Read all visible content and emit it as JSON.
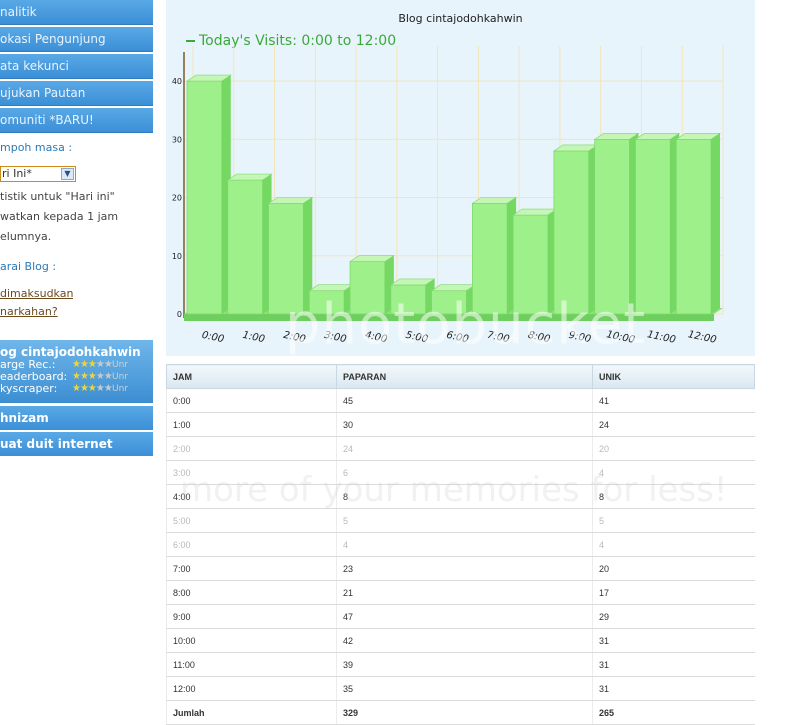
{
  "sidebar": {
    "menu": [
      "nalitik",
      "okasi Pengunjung",
      "ata kekunci",
      "ujukan Pautan",
      "omuniti *BARU!"
    ],
    "period_label": "mpoh masa :",
    "period_value": "ri Ini*",
    "note_lines": [
      "tistik untuk \"Hari ini\"",
      "watkan kepada 1 jam",
      "elumnya."
    ],
    "blog_list_label": "arai Blog :",
    "links": [
      "dimaksudkan",
      "narkahan?"
    ],
    "blog_box": {
      "title": "og cintajodohkahwin",
      "rows": [
        {
          "label": "arge Rec.:",
          "rank": "Unr"
        },
        {
          "label": "eaderboard:",
          "rank": "Unr"
        },
        {
          "label": "kyscraper:",
          "rank": "Unr"
        }
      ]
    },
    "buttons": [
      "hnizam",
      "uat duit internet"
    ]
  },
  "chart_data": {
    "type": "bar",
    "title": "Blog cintajodohkahwin",
    "series": [
      {
        "name": "Today's Visits: 0:00 to 12:00",
        "values": [
          40,
          23,
          19,
          4,
          9,
          5,
          4,
          19,
          17,
          28,
          30,
          30,
          30
        ]
      }
    ],
    "categories": [
      "0:00",
      "1:00",
      "2:00",
      "3:00",
      "4:00",
      "5:00",
      "6:00",
      "7:00",
      "8:00",
      "9:00",
      "10:00",
      "11:00",
      "12:00"
    ],
    "ylim": [
      0,
      45
    ],
    "yticks": [
      0,
      10,
      20,
      30,
      40
    ],
    "grid": true,
    "colors": {
      "bar": "#9ef08a",
      "bar_dark": "#6fd65e",
      "legend": "#3aa93a"
    }
  },
  "table": {
    "headers": [
      "JAM",
      "PAPARAN",
      "UNIK"
    ],
    "rows": [
      {
        "jam": "0:00",
        "paparan": "45",
        "unik": "41",
        "dim": false
      },
      {
        "jam": "1:00",
        "paparan": "30",
        "unik": "24",
        "dim": false
      },
      {
        "jam": "2:00",
        "paparan": "24",
        "unik": "20",
        "dim": true
      },
      {
        "jam": "3:00",
        "paparan": "6",
        "unik": "4",
        "dim": true
      },
      {
        "jam": "4:00",
        "paparan": "8",
        "unik": "8",
        "dim": false
      },
      {
        "jam": "5:00",
        "paparan": "5",
        "unik": "5",
        "dim": true
      },
      {
        "jam": "6:00",
        "paparan": "4",
        "unik": "4",
        "dim": true
      },
      {
        "jam": "7:00",
        "paparan": "23",
        "unik": "20",
        "dim": false
      },
      {
        "jam": "8:00",
        "paparan": "21",
        "unik": "17",
        "dim": false
      },
      {
        "jam": "9:00",
        "paparan": "47",
        "unik": "29",
        "dim": false
      },
      {
        "jam": "10:00",
        "paparan": "42",
        "unik": "31",
        "dim": false
      },
      {
        "jam": "11:00",
        "paparan": "39",
        "unik": "31",
        "dim": false
      },
      {
        "jam": "12:00",
        "paparan": "35",
        "unik": "31",
        "dim": false
      }
    ],
    "total": {
      "jam": "Jumlah",
      "paparan": "329",
      "unik": "265"
    }
  },
  "watermark": {
    "main": "photobucket",
    "sub": "more of your memories for less!"
  }
}
